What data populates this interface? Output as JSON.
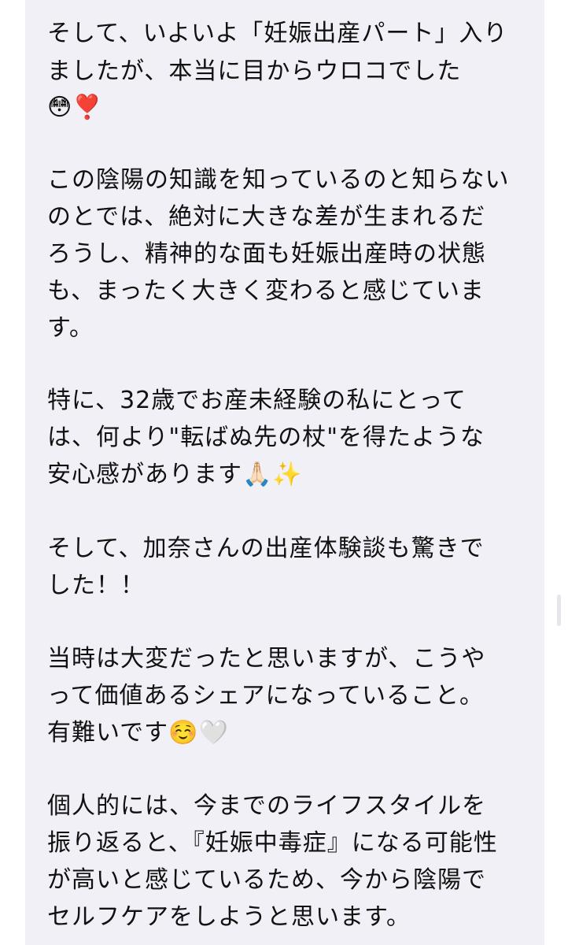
{
  "message": {
    "paragraphs": [
      {
        "lines": [
          "そして、いよいよ「妊娠出産パート」入り",
          "ましたが、本当に目からウロコでした",
          "😳❣️"
        ]
      },
      {
        "lines": [
          "この陰陽の知識を知っているのと知らない",
          "のとでは、絶対に大きな差が生まれるだ",
          "ろうし、精神的な面も妊娠出産時の状態",
          "も、まったく大きく変わると感じていま",
          "す。"
        ]
      },
      {
        "lines": [
          "特に、32歳でお産未経験の私にとって",
          "は、何より\"転ばぬ先の杖\"を得たような",
          "安心感があります🙏🏻✨"
        ]
      },
      {
        "lines": [
          "そして、加奈さんの出産体験談も驚きで",
          "した！！"
        ]
      },
      {
        "lines": [
          "当時は大変だったと思いますが、こうや",
          "って価値あるシェアになっていること。",
          "有難いです☺️🤍"
        ]
      },
      {
        "lines": [
          "個人的には、今までのライフスタイルを",
          "振り返ると、『妊娠中毒症』になる可能性",
          "が高いと感じているため、今から陰陽で",
          "セルフケアをしようと思います。"
        ]
      }
    ]
  }
}
